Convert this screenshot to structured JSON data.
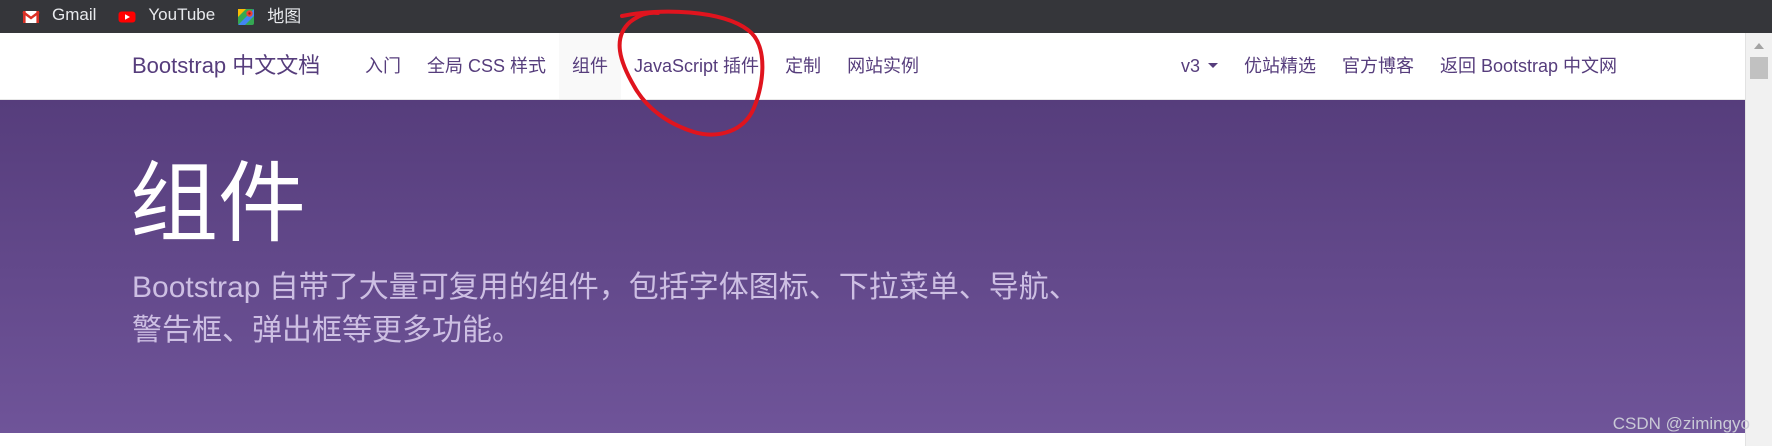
{
  "bookmarks": [
    {
      "label": "Gmail",
      "icon": "gmail-icon"
    },
    {
      "label": "YouTube",
      "icon": "youtube-icon"
    },
    {
      "label": "地图",
      "icon": "maps-icon"
    }
  ],
  "navbar": {
    "brand": "Bootstrap 中文文档",
    "left_items": [
      "入门",
      "全局 CSS 样式",
      "组件",
      "JavaScript 插件",
      "定制",
      "网站实例"
    ],
    "active_item": "组件",
    "right_items": [
      "v3",
      "优站精选",
      "官方博客",
      "返回 Bootstrap 中文网"
    ]
  },
  "hero": {
    "title": "组件",
    "lead_line1": "Bootstrap 自带了大量可复用的组件，包括字体图标、下拉菜单、导航、",
    "lead_line2": "警告框、弹出框等更多功能。"
  },
  "watermark": "CSDN @zimingyo",
  "colors": {
    "bookmarks_bg": "#35363a",
    "brand_purple": "#563d7c",
    "hero_top": "#563d7c",
    "hero_bottom": "#6f5499",
    "lead_text": "#cdbfe3",
    "annotation_red": "#e0141e"
  }
}
